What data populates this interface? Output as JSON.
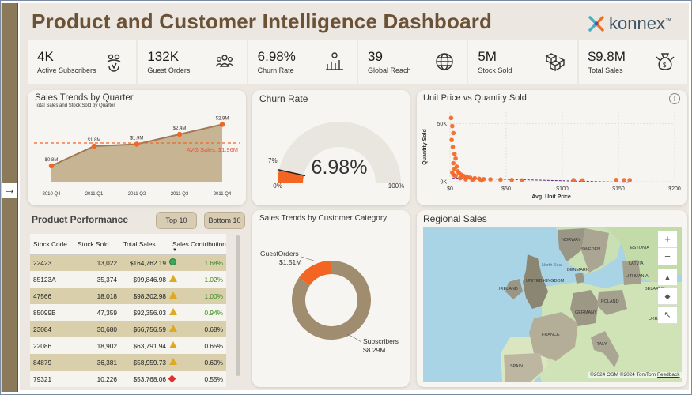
{
  "dashboard": {
    "title": "Product and Customer Intelligence Dashboard",
    "logo_text": "konnex",
    "logo_tm": "™"
  },
  "nav": {
    "expand_glyph": "→"
  },
  "kpis": [
    {
      "value": "4K",
      "label": "Active Subscribers",
      "icon": "subscriber-icon"
    },
    {
      "value": "132K",
      "label": "Guest Orders",
      "icon": "guests-icon"
    },
    {
      "value": "6.98%",
      "label": "Churn Rate",
      "icon": "churn-icon"
    },
    {
      "value": "39",
      "label": "Global Reach",
      "icon": "globe-icon"
    },
    {
      "value": "5M",
      "label": "Stock Sold",
      "icon": "boxes-icon"
    },
    {
      "value": "$9.8M",
      "label": "Total Sales",
      "icon": "money-bag-icon"
    }
  ],
  "sales_trend": {
    "title": "Sales Trends by Quarter",
    "subtitle": "Total Sales and Stock Sold by Quarter",
    "avg_label": "AVG Sales: $1.96M"
  },
  "churn": {
    "title": "Churn Rate",
    "value": "6.98%",
    "min_label": "0%",
    "max_label": "100%",
    "marker_label": "7%",
    "fraction": 0.0698
  },
  "scatter": {
    "title": "Unit Price vs Quantity Sold",
    "info_glyph": "!"
  },
  "product_performance": {
    "title": "Product Performance",
    "btn_top": "Top 10",
    "btn_bottom": "Bottom 10",
    "columns": [
      "Stock Code",
      "Stock Sold",
      "Total Sales",
      "Sales Contribution"
    ],
    "rows": [
      {
        "code": "22423",
        "sold": "13,022",
        "sales": "$164,762.19",
        "status": "up",
        "contrib": "1.68%"
      },
      {
        "code": "85123A",
        "sold": "35,374",
        "sales": "$99,846.98",
        "status": "mid",
        "contrib": "1.02%"
      },
      {
        "code": "47566",
        "sold": "18,018",
        "sales": "$98,302.98",
        "status": "mid",
        "contrib": "1.00%"
      },
      {
        "code": "85099B",
        "sold": "47,359",
        "sales": "$92,356.03",
        "status": "mid",
        "contrib": "0.94%"
      },
      {
        "code": "23084",
        "sold": "30,680",
        "sales": "$66,756.59",
        "status": "mid",
        "contrib": "0.68%"
      },
      {
        "code": "22086",
        "sold": "18,902",
        "sales": "$63,791.94",
        "status": "mid",
        "contrib": "0.65%"
      },
      {
        "code": "84879",
        "sold": "36,381",
        "sales": "$58,959.73",
        "status": "mid",
        "contrib": "0.60%"
      },
      {
        "code": "79321",
        "sold": "10,226",
        "sales": "$53,768.06",
        "status": "down",
        "contrib": "0.55%"
      }
    ]
  },
  "category": {
    "title": "Sales Trends by Customer Category",
    "guest_label": "GuestOrders",
    "guest_value": "$1.51M",
    "sub_label": "Subscribers",
    "sub_value": "$8.29M"
  },
  "regional": {
    "title": "Regional Sales",
    "labels": [
      "North Sea",
      "UNITED KINGDOM",
      "FRANCE",
      "SWEDEN",
      "NORWAY",
      "LATVIA",
      "LITHUANIA",
      "POLAND",
      "GERMANY",
      "BELARUS",
      "UKRAINE",
      "IRELAND",
      "DENMARK",
      "ESTONIA",
      "SPAIN",
      "ITALY"
    ],
    "attribution": "©2024 OSM ©2024 TomTom",
    "feedback": "Feedback",
    "controls": [
      "+",
      "−",
      "▲",
      "◆",
      "↖"
    ]
  },
  "chart_data": [
    {
      "type": "line",
      "title": "Sales Trends by Quarter",
      "subtitle": "Total Sales and Stock Sold by Quarter",
      "categories": [
        "2010 Q4",
        "2011 Q1",
        "2011 Q2",
        "2011 Q3",
        "2011 Q4"
      ],
      "series": [
        {
          "name": "Total Sales",
          "values": [
            0.8,
            1.8,
            1.9,
            2.4,
            2.9
          ],
          "value_labels": [
            "$0.8M",
            "$1.8M",
            "$1.9M",
            "$2.4M",
            "$2.9M"
          ]
        }
      ],
      "area_under_line": true,
      "reference_line": {
        "label": "AVG Sales: $1.96M",
        "value": 1.96
      },
      "ylim": [
        0,
        3.2
      ]
    },
    {
      "type": "scatter",
      "title": "Unit Price vs Quantity Sold",
      "xlabel": "Avg. Unit Price",
      "ylabel": "Quantity Sold",
      "xlim": [
        0,
        200
      ],
      "ylim": [
        0,
        60000
      ],
      "xticks": [
        "$0",
        "$50",
        "$100",
        "$150",
        "$200"
      ],
      "yticks": [
        "0K",
        "50K"
      ],
      "trend_line": true,
      "points": [
        [
          1,
          55000
        ],
        [
          2,
          48000
        ],
        [
          3,
          42000
        ],
        [
          1.5,
          36000
        ],
        [
          2.5,
          30000
        ],
        [
          4,
          24000
        ],
        [
          5,
          20000
        ],
        [
          3,
          16000
        ],
        [
          6,
          13000
        ],
        [
          4,
          11000
        ],
        [
          7,
          9000
        ],
        [
          8,
          7500
        ],
        [
          10,
          6000
        ],
        [
          12,
          5000
        ],
        [
          15,
          4500
        ],
        [
          18,
          3500
        ],
        [
          22,
          3000
        ],
        [
          26,
          2500
        ],
        [
          30,
          2200
        ],
        [
          36,
          2000
        ],
        [
          45,
          1800
        ],
        [
          55,
          1500
        ],
        [
          64,
          1200
        ],
        [
          2,
          8000
        ],
        [
          3,
          6000
        ],
        [
          5,
          5000
        ],
        [
          9,
          3000
        ],
        [
          14,
          2000
        ],
        [
          20,
          1500
        ],
        [
          28,
          1000
        ],
        [
          110,
          1400
        ],
        [
          118,
          1200
        ],
        [
          148,
          1500
        ],
        [
          155,
          1300
        ],
        [
          160,
          1400
        ]
      ]
    },
    {
      "type": "pie",
      "title": "Sales Trends by Customer Category",
      "donut": true,
      "slices": [
        {
          "label": "GuestOrders",
          "value": 1.51,
          "display": "$1.51M"
        },
        {
          "label": "Subscribers",
          "value": 8.29,
          "display": "$8.29M"
        }
      ]
    }
  ],
  "colors": {
    "accent_orange": "#f26522",
    "line_brown": "#a07a55",
    "area_fill": "#c4b08c",
    "donut_tan": "#a08c6e",
    "avg_red": "#e5533c",
    "title_brown": "#6b5236",
    "trend_purple": "#5a2a7a"
  }
}
